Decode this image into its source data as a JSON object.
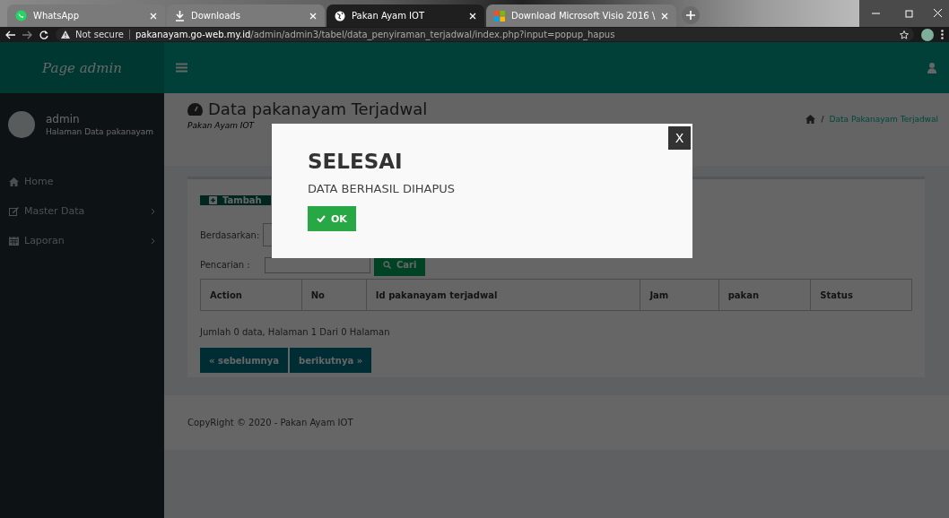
{
  "browser": {
    "tabs": [
      {
        "title": "WhatsApp",
        "selected": false
      },
      {
        "title": "Downloads",
        "selected": false
      },
      {
        "title": "Pakan Ayam IOT",
        "selected": true
      },
      {
        "title": "Download Microsoft Visio 2016 \\",
        "selected": false
      }
    ],
    "security": "Not secure",
    "url_host": "pakanayam.go-web.my.id",
    "url_path": "/admin/admin3/tabel/data_penyiraman_terjadwal/index.php?input=popup_hapus"
  },
  "brand": "Page admin",
  "sidebar": {
    "user_name": "admin",
    "user_subtitle": "Halaman Data pakanayam",
    "items": [
      {
        "label": "Home",
        "has_submenu": false
      },
      {
        "label": "Master Data",
        "has_submenu": true
      },
      {
        "label": "Laporan",
        "has_submenu": true
      }
    ]
  },
  "page": {
    "title": "Data pakanayam Terjadwal",
    "subtitle": "Pakan Ayam IOT",
    "breadcrumb_separator": "/",
    "breadcrumb": "Data Pakanayam Terjadwal"
  },
  "add_button": "Tambah",
  "filter_label": "Berdasarkan:",
  "search_label": "Pencarian :",
  "search_button": "Cari",
  "table": {
    "columns": [
      "Action",
      "No",
      "Id pakanayam terjadwal",
      "Jam",
      "pakan",
      "Status"
    ]
  },
  "summary": "Jumlah 0 data, Halaman 1 Dari 0 Halaman",
  "pager": [
    "« sebelumnya",
    "berikutnya »"
  ],
  "footer": "CopyRight © 2020 - Pakan Ayam IOT",
  "modal": {
    "close": "X",
    "title": "SELESAI",
    "message": "DATA BERHASIL DIHAPUS",
    "ok": "OK"
  }
}
